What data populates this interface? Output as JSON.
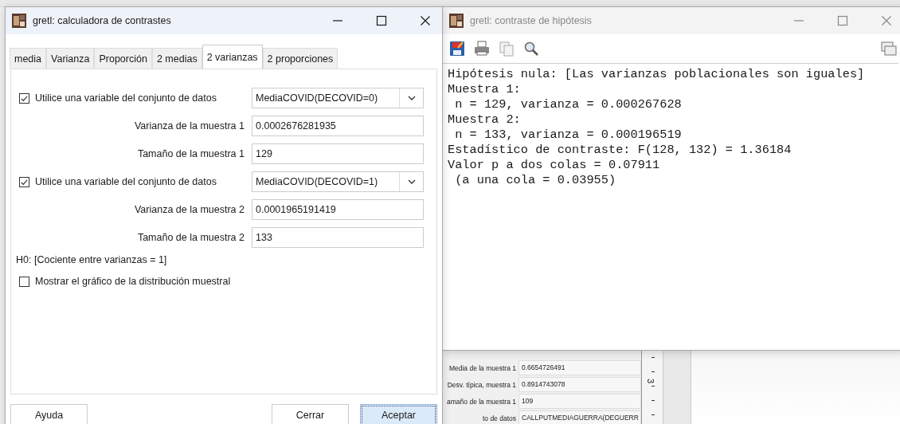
{
  "background_window": {
    "fields": [
      {
        "label": "Media de la muestra 1",
        "value": "0.6654726491"
      },
      {
        "label": "Desv. típica, muestra 1",
        "value": "0.8914743078"
      },
      {
        "label": "amaño de la muestra 1",
        "value": "109"
      },
      {
        "label": "to de datos",
        "value": "CALLPUTMEDIAGUERRA(DEGUERR"
      }
    ],
    "ruler_label": "3"
  },
  "calculator": {
    "title": "gretl: calculadora de contrastes",
    "active": true,
    "tabs": [
      {
        "label": "media",
        "selected": false
      },
      {
        "label": "Varianza",
        "selected": false
      },
      {
        "label": "Proporción",
        "selected": false
      },
      {
        "label": "2 medias",
        "selected": false
      },
      {
        "label": "2 varianzas",
        "selected": true
      },
      {
        "label": "2 proporciones",
        "selected": false
      }
    ],
    "rows": [
      {
        "kind": "dataset",
        "label": "Utilice una variable del conjunto de datos",
        "checked": true,
        "value": "MediaCOVID(DECOVID=0)"
      },
      {
        "kind": "field",
        "label": "Varianza de la muestra 1",
        "value": "0.0002676281935"
      },
      {
        "kind": "field",
        "label": "Tamaño de la muestra 1",
        "value": "129"
      },
      {
        "kind": "dataset",
        "label": "Utilice una variable del conjunto de datos",
        "checked": true,
        "value": "MediaCOVID(DECOVID=1)"
      },
      {
        "kind": "field",
        "label": "Varianza de la muestra 2",
        "value": "0.0001965191419"
      },
      {
        "kind": "field",
        "label": "Tamaño de la muestra 2",
        "value": "133"
      }
    ],
    "hypothesis": "H0: [Cociente entre varianzas = 1]",
    "show_graph": {
      "label": "Mostrar el gráfico de la distribución muestral",
      "checked": false
    },
    "buttons": [
      {
        "label": "Ayuda",
        "default": false
      },
      {
        "label": "Cerrar",
        "default": false
      },
      {
        "label": "Aceptar",
        "default": true
      }
    ]
  },
  "result": {
    "title": "gretl: contraste de hipótesis",
    "active": false,
    "lines": [
      "Hipótesis nula: [Las varianzas poblacionales son iguales]",
      "Muestra 1:",
      " n = 129, varianza = 0.000267628",
      "Muestra 2:",
      " n = 133, varianza = 0.000196519",
      "Estadístico de contraste: F(128, 132) = 1.36184",
      "Valor p a dos colas = 0.07911",
      " (a una cola = 0.03955)"
    ]
  }
}
